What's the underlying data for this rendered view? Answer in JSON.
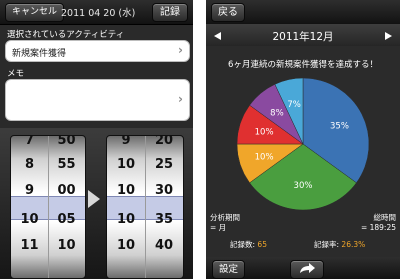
{
  "left": {
    "topbar": {
      "cancel": "キャンセル",
      "date": "2011  04  20 (水)",
      "save": "記録"
    },
    "activity": {
      "label": "選択されているアクティビティ",
      "value": "新規案件獲得"
    },
    "memo": {
      "label": "メモ",
      "value": ""
    },
    "picker": {
      "hours": [
        "7",
        "8",
        "9",
        "10",
        "11"
      ],
      "minutes": [
        "50",
        "55",
        "00",
        "05",
        "10"
      ],
      "hours2": [
        "9",
        "10",
        "10",
        "10",
        "10"
      ],
      "minutes2": [
        "20",
        "25",
        "30",
        "35",
        "40"
      ]
    }
  },
  "right": {
    "topbar": {
      "back": "戻る"
    },
    "month": "2011年12月",
    "headline": "6ヶ月連続の新規案件獲得を達成する！",
    "chart_data": {
      "type": "pie",
      "slices": [
        {
          "label": "35%",
          "value": 35,
          "color": "#3b73b4"
        },
        {
          "label": "30%",
          "value": 30,
          "color": "#4a9e3f"
        },
        {
          "label": "10%",
          "value": 10,
          "color": "#f0a62a"
        },
        {
          "label": "10%",
          "value": 10,
          "color": "#e03030"
        },
        {
          "label": "8%",
          "value": 8,
          "color": "#8a4aa0"
        },
        {
          "label": "7%",
          "value": 7,
          "color": "#4aa8d8"
        }
      ]
    },
    "stats": {
      "period_label": "分析期間",
      "period_value": "= 月",
      "total_label": "総時間",
      "total_value": "= 189:25",
      "count_label": "記録数:",
      "count_value": "65",
      "rate_label": "記録率:",
      "rate_value": "26.3%"
    },
    "bottombar": {
      "settings": "設定"
    },
    "colors": {
      "accent": "#f0a62a"
    }
  }
}
